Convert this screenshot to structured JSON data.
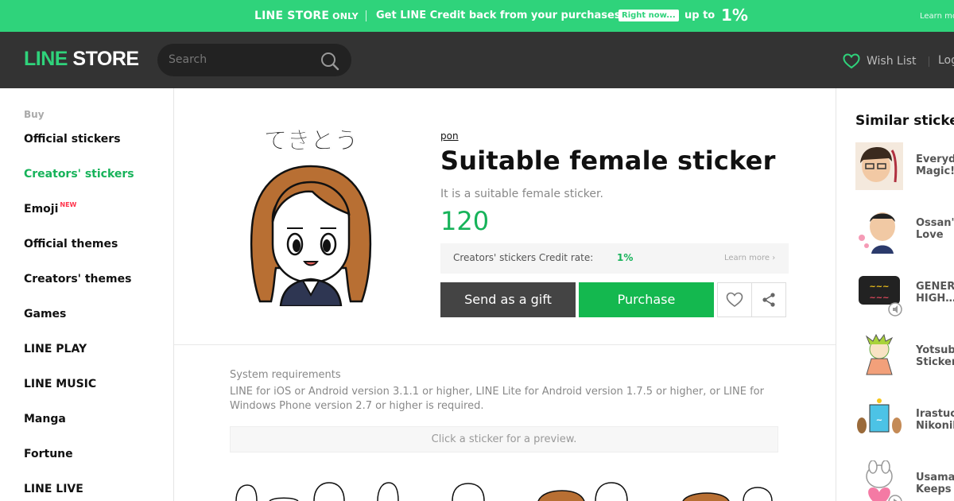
{
  "promo": {
    "brand": "LINE STORE",
    "only": "ONLY",
    "message": "Get LINE Credit back from your purchases!",
    "badge": "Right now...",
    "up_to": "up to",
    "rate": "1%",
    "learn_more": "Learn more"
  },
  "header": {
    "logo_line": "LINE",
    "logo_store": "STORE",
    "search_placeholder": "Search",
    "wish_list": "Wish List",
    "login": "Log"
  },
  "nav": {
    "heading": "Buy",
    "items": [
      {
        "label": "Official stickers"
      },
      {
        "label": "Creators' stickers",
        "active": true
      },
      {
        "label": "Emoji",
        "badge": "NEW"
      },
      {
        "label": "Official themes"
      },
      {
        "label": "Creators' themes"
      },
      {
        "label": "Games"
      },
      {
        "label": "LINE PLAY"
      },
      {
        "label": "LINE MUSIC"
      },
      {
        "label": "Manga"
      },
      {
        "label": "Fortune"
      },
      {
        "label": "LINE LIVE"
      }
    ]
  },
  "product": {
    "author": "pon",
    "title": "Suitable female sticker",
    "description": "It is a suitable female sticker.",
    "price": "120",
    "credit_label": "Creators' stickers Credit rate:",
    "credit_rate": "1%",
    "credit_more": "Learn more",
    "gift_button": "Send as a gift",
    "purchase_button": "Purchase",
    "sticker_caption": "てきとう",
    "sysreq_heading": "System requirements",
    "sysreq_text": "LINE for iOS or Android version 3.1.1 or higher, LINE Lite for Android version 1.7.5 or higher, or LINE for Windows Phone version 2.7 or higher is required.",
    "preview_hint": "Click a sticker for a preview."
  },
  "similar": {
    "title": "Similar stickers",
    "items": [
      {
        "name_line1": "Everyd",
        "name_line2": "Magic!"
      },
      {
        "name_line1": "Ossan'",
        "name_line2": "Love"
      },
      {
        "name_line1": "GENER",
        "name_line2": "HIGH…"
      },
      {
        "name_line1": "Yotsub",
        "name_line2": "Sticker"
      },
      {
        "name_line1": "Irastuc",
        "name_line2": "Nikonil"
      },
      {
        "name_line1": "Usama",
        "name_line2": "Keeps"
      }
    ]
  },
  "colors": {
    "accent": "#2fd37b",
    "accent_dark": "#17b35a",
    "header_bg": "#333333",
    "purchase_bg": "#14b84f",
    "gift_bg": "#444444"
  }
}
